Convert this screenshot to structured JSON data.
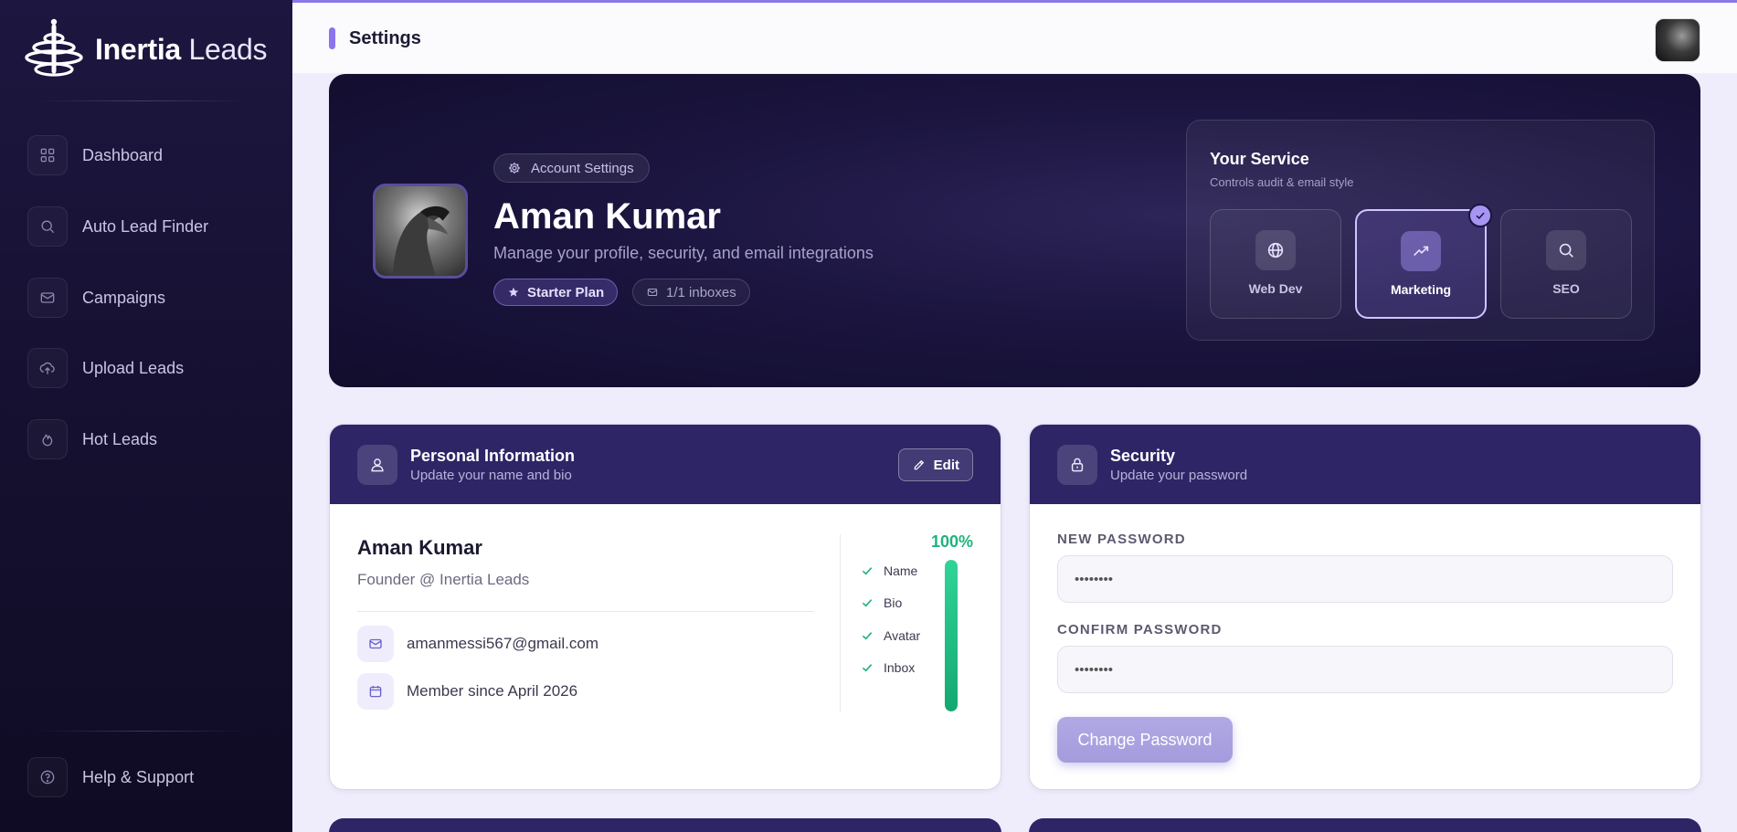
{
  "app": {
    "name_bold": "Inertia",
    "name_light": "Leads"
  },
  "sidebar": {
    "items": [
      {
        "label": "Dashboard",
        "icon": "grid-icon"
      },
      {
        "label": "Auto Lead Finder",
        "icon": "search-icon"
      },
      {
        "label": "Campaigns",
        "icon": "mail-icon"
      },
      {
        "label": "Upload Leads",
        "icon": "upload-cloud-icon"
      },
      {
        "label": "Hot Leads",
        "icon": "flame-icon"
      }
    ],
    "help": {
      "label": "Help & Support",
      "icon": "help-circle-icon"
    }
  },
  "topbar": {
    "title": "Settings"
  },
  "hero": {
    "chip_label": "Account Settings",
    "name": "Aman Kumar",
    "subtitle": "Manage your profile, security, and email integrations",
    "plan_label": "Starter Plan",
    "inbox_label": "1/1 inboxes",
    "service": {
      "title": "Your Service",
      "subtitle": "Controls audit & email style",
      "options": [
        {
          "label": "Web Dev",
          "icon": "globe-icon",
          "selected": false
        },
        {
          "label": "Marketing",
          "icon": "trending-up-icon",
          "selected": true
        },
        {
          "label": "SEO",
          "icon": "search-icon",
          "selected": false
        }
      ]
    }
  },
  "personal_info": {
    "title": "Personal Information",
    "subtitle": "Update your name and bio",
    "edit_label": "Edit",
    "name": "Aman Kumar",
    "bio": "Founder @ Inertia Leads",
    "email": "amanmessi567@gmail.com",
    "member_since": "Member since April 2026",
    "completion_label": "100%",
    "completion_value": 1.0,
    "checklist": [
      "Name",
      "Bio",
      "Avatar",
      "Inbox"
    ]
  },
  "security": {
    "title": "Security",
    "subtitle": "Update your password",
    "new_password_label": "NEW PASSWORD",
    "new_password_value": "••••••••",
    "confirm_password_label": "CONFIRM PASSWORD",
    "confirm_password_value": "••••••••",
    "button_label": "Change Password"
  },
  "colors": {
    "accent": "#8b74ee",
    "card_header": "#2e2566",
    "success": "#1fb37c",
    "sidebar_bg": "#15102f"
  }
}
